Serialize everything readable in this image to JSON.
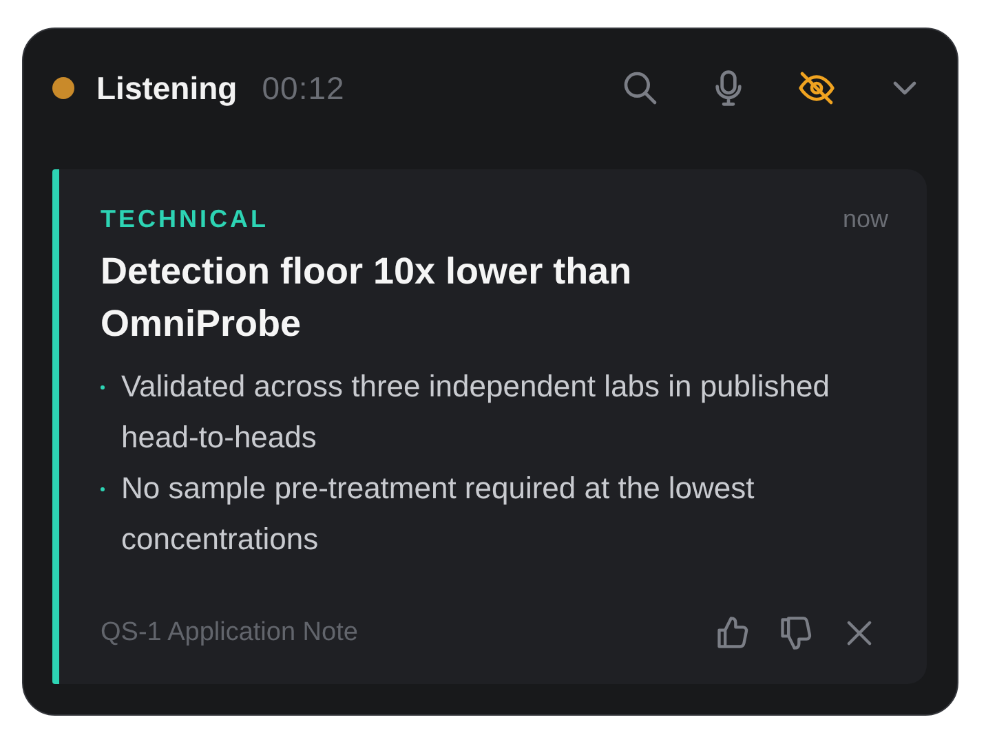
{
  "status": {
    "label": "Listening",
    "color": "#c98a2a",
    "elapsed": "00:12"
  },
  "toolbar": [
    {
      "kind": "search",
      "active": false
    },
    {
      "kind": "mic",
      "active": false
    },
    {
      "kind": "hide",
      "active": true
    },
    {
      "kind": "collapse",
      "active": false
    }
  ],
  "card": {
    "category": "TECHNICAL",
    "color": "#2dd4b4",
    "time": "now",
    "title": "Detection floor 10x lower than OmniProbe",
    "bullets": [
      "Validated across three independent labs in published head-to-heads",
      "No sample pre-treatment required at the lowest concentrations"
    ],
    "source": "QS-1 Application Note",
    "actions": [
      {
        "kind": "like"
      },
      {
        "kind": "dislike"
      },
      {
        "kind": "dismiss"
      }
    ]
  }
}
